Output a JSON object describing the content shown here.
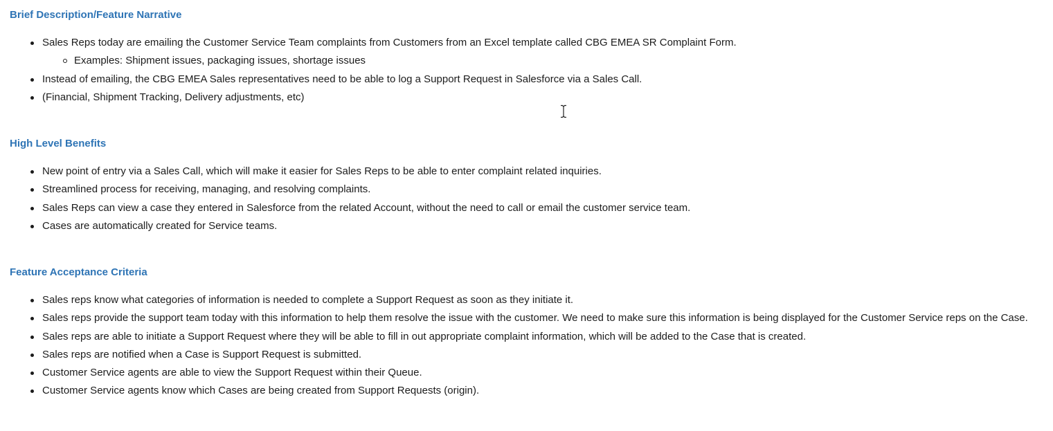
{
  "sections": [
    {
      "heading": "Brief Description/Feature Narrative",
      "items": [
        {
          "text": "Sales Reps today are emailing the Customer Service Team complaints from Customers from an Excel template called CBG EMEA SR Complaint Form.",
          "sub": [
            "Examples: Shipment issues, packaging issues, shortage issues"
          ]
        },
        {
          "text": "Instead of emailing, the CBG EMEA Sales representatives need to be able to log a Support Request in Salesforce via a Sales Call."
        },
        {
          "text": "(Financial, Shipment Tracking, Delivery adjustments, etc)"
        }
      ]
    },
    {
      "heading": "High Level Benefits",
      "items": [
        {
          "text": "New point of entry via a Sales Call, which will make it easier for Sales Reps to be able to enter complaint related inquiries."
        },
        {
          "text": "Streamlined process for receiving, managing, and resolving complaints."
        },
        {
          "text": "Sales Reps can view a case they entered in Salesforce from the related Account, without the need to call or email the customer service team."
        },
        {
          "text": "Cases are automatically created for Service teams."
        }
      ]
    },
    {
      "heading": "Feature Acceptance Criteria",
      "items": [
        {
          "text": "Sales reps know what categories of information is needed to complete a Support Request as soon as they initiate it."
        },
        {
          "text": "Sales reps provide the support team today with this information to help them resolve the issue with the customer. We need to make sure this information is being displayed for the Customer Service reps on the Case."
        },
        {
          "text": "Sales reps are able to initiate a Support Request where they will be able to fill in out appropriate complaint information, which will be added to the Case that is created."
        },
        {
          "text": "Sales reps are notified when a Case is Support Request is submitted."
        },
        {
          "text": "Customer Service agents are able to view the Support Request within their Queue."
        },
        {
          "text": "Customer Service agents know which Cases are being created from Support Requests (origin)."
        }
      ]
    }
  ],
  "icons": {
    "cursor": "text-cursor-icon"
  },
  "colors": {
    "heading": "#2e74b5",
    "text": "#1c1c1c",
    "background": "#ffffff"
  }
}
